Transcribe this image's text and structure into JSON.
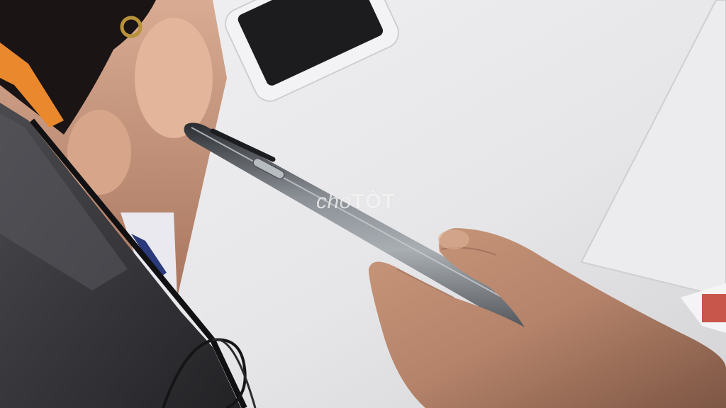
{
  "photo": {
    "subject": "phone-side-profile-in-hand",
    "colors": {
      "table": "#e8e8ea",
      "monitor": "#3a3a3e",
      "phone_frame": "#6f7378",
      "skin": "#b9876a",
      "poster": "#c99a84"
    }
  },
  "watermark": {
    "part1": "cho",
    "part2": "TỐT"
  }
}
